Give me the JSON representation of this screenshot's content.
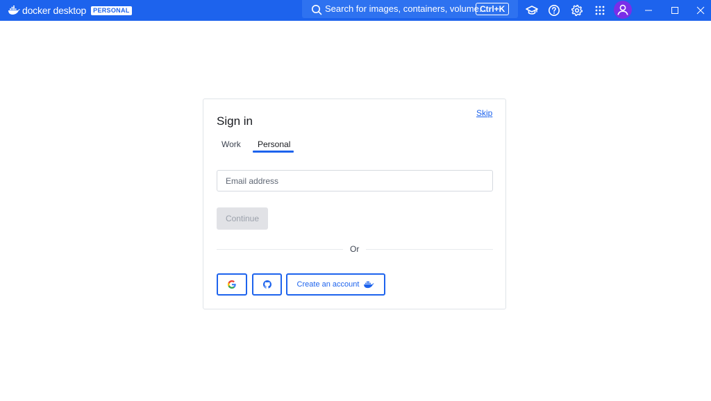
{
  "titlebar": {
    "brand": "docker desktop",
    "plan_badge": "PERSONAL",
    "search_placeholder": "Search for images, containers, volume...",
    "search_shortcut": "Ctrl+K",
    "icons": [
      "learning-center-icon",
      "help-icon",
      "settings-icon",
      "extensions-grid-icon",
      "account-avatar-icon"
    ],
    "colors": {
      "bar": "#1d63ed",
      "avatar": "#7a2ee8"
    }
  },
  "signin": {
    "title": "Sign in",
    "skip": "Skip",
    "tabs": [
      {
        "label": "Work",
        "active": false
      },
      {
        "label": "Personal",
        "active": true
      }
    ],
    "email_placeholder": "Email address",
    "continue_label": "Continue",
    "divider_text": "Or",
    "create_account_label": "Create an account",
    "social_icons": [
      "google-icon",
      "github-icon",
      "docker-whale-icon"
    ]
  }
}
